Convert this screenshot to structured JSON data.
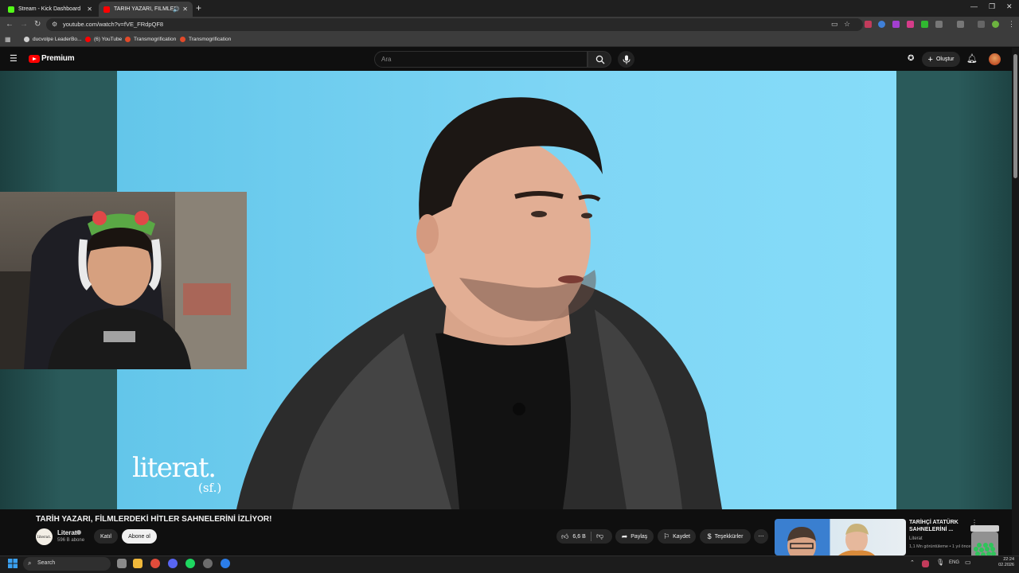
{
  "browser": {
    "tabs": [
      {
        "title": "Stream - Kick Dashboard",
        "favicon_color": "#53fc18"
      },
      {
        "title": "TARİH YAZARI, FİLMLERDE",
        "favicon_color": "#ff0000"
      }
    ],
    "new_tab_label": "+",
    "url": "youtube.com/watch?v=fVE_FRdpQF8",
    "bookmarks": [
      {
        "label": "ducvolpe LeaderBo...",
        "color": "#cfcfcf"
      },
      {
        "label": "(6) YouTube",
        "color": "#ff0000"
      },
      {
        "label": "Transmogrification",
        "color": "#e24a2a"
      },
      {
        "label": "Transmogrification",
        "color": "#e24a2a"
      }
    ]
  },
  "youtube": {
    "brand": "Premium",
    "search_placeholder": "Ara",
    "create_label": "Oluştur",
    "video": {
      "watermark": "literat.",
      "watermark_sub": "(sf.)",
      "title": "TARİH YAZARI, FİLMLERDEKİ HİTLER SAHNELERİNİ İZLİYOR!"
    },
    "channel": {
      "name": "Literat",
      "avatar_text": "literat.",
      "subscribers": "596 B abone",
      "join_label": "Katıl",
      "subscribe_label": "Abone ol"
    },
    "actions": {
      "likes": "6,6 B",
      "share": "Paylaş",
      "save": "Kaydet",
      "thanks": "Teşekkürler",
      "more": "⋯"
    },
    "recommended": {
      "title": "TARİHÇİ ATATÜRK SAHNELERİNİ ...",
      "channel": "Literat",
      "meta": "1,1 Mn görüntüleme • 1 yıl önce"
    }
  },
  "taskbar": {
    "search_label": "Search",
    "language": "ENG",
    "time": "22:24",
    "date": "02.2026"
  },
  "colors": {
    "youtube_red": "#ff0000",
    "video_bg": "#7fd6f5",
    "kick_green": "#53fc18"
  }
}
